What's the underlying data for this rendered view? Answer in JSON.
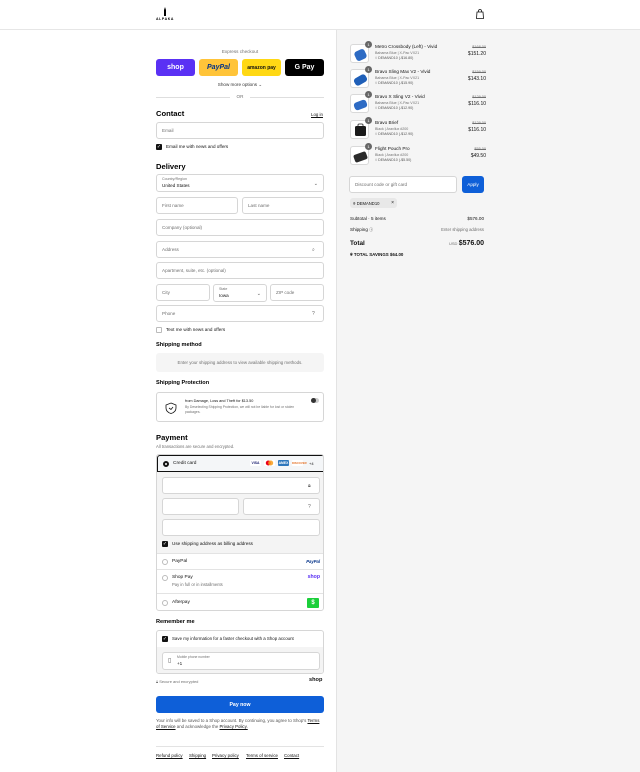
{
  "brand": {
    "name": "ALPAKA"
  },
  "express": {
    "title": "Express checkout",
    "buttons": [
      "shop",
      "PayPal",
      "amazon pay",
      "G Pay"
    ],
    "more": "Show more options",
    "or": "OR"
  },
  "contact": {
    "title": "Contact",
    "login": "Log in",
    "email_placeholder": "Email",
    "newsletter": "Email me with news and offers"
  },
  "delivery": {
    "title": "Delivery",
    "country_label": "Country/Region",
    "country_value": "United States",
    "first_name": "First name",
    "last_name": "Last name",
    "company": "Company (optional)",
    "address": "Address",
    "apartment": "Apartment, suite, etc. (optional)",
    "city": "City",
    "state_label": "State",
    "state_value": "Iowa",
    "zip": "ZIP code",
    "phone": "Phone",
    "text_offers": "Text me with news and offers"
  },
  "shipping_method": {
    "title": "Shipping method",
    "note": "Enter your shipping address to view available shipping methods."
  },
  "protection": {
    "title": "Shipping Protection",
    "line1": "from Damage, Loss and Theft for $13.50",
    "line2": "By Deselecting Shipping Protection, we will not be liable for lost or stolen",
    "line3": "packages."
  },
  "payment": {
    "title": "Payment",
    "subtitle": "All transactions are secure and encrypted.",
    "credit_card": "Credit card",
    "card_more": "+4",
    "billing_same": "Use shipping address as billing address",
    "options": [
      {
        "label": "PayPal",
        "logo": "PayPal"
      },
      {
        "label": "Shop Pay",
        "sub": "Pay in full or in installments",
        "logo": "shop"
      },
      {
        "label": "Afterpay",
        "logo": "$"
      }
    ]
  },
  "remember": {
    "title": "Remember me",
    "save_info": "Save my information for a faster checkout with a Shop account",
    "mobile_label": "Mobile phone number",
    "mobile_value": "+1",
    "secure": "Secure and encrypted",
    "shop_logo": "shop"
  },
  "pay_now": "Pay now",
  "legal": {
    "text1": "Your info will be saved to a Shop account. By continuing, you agree to Shop's",
    "terms": "Terms of Service",
    "and": "and acknowledge the",
    "privacy": "Privacy Policy."
  },
  "footer_links": [
    "Refund policy",
    "Shipping",
    "Privacy policy",
    "Terms of service",
    "Contact"
  ],
  "cart": {
    "items": [
      {
        "qty": "1",
        "name": "Metro Crossbody (Left) - Vivid",
        "variant": "Bahama Blue | X-Pac VX21",
        "code": "DEMAND10 (-$16.80)",
        "old": "$168.00",
        "price": "$151.20",
        "color": "#2d6bc4"
      },
      {
        "qty": "1",
        "name": "Bravo Sling Max V2 - Vivid",
        "variant": "Bahama Blue | X-Pac VX21",
        "code": "DEMAND10 (-$15.90)",
        "old": "$159.00",
        "price": "$143.10",
        "color": "#2d6bc4"
      },
      {
        "qty": "1",
        "name": "Bravo X Sling V2 - Vivid",
        "variant": "Bahama Blue | X-Pac VX21",
        "code": "DEMAND10 (-$12.90)",
        "old": "$129.00",
        "price": "$116.10",
        "color": "#2d6bc4"
      },
      {
        "qty": "1",
        "name": "Bravo Brief",
        "variant": "Black | Aravllux #200",
        "code": "DEMAND10 (-$12.90)",
        "old": "$129.00",
        "price": "$116.10",
        "color": "#1b1b1b"
      },
      {
        "qty": "1",
        "name": "Flight Pouch Pro",
        "variant": "Black | Aravllux #200",
        "code": "DEMAND10 (-$5.50)",
        "old": "$55.00",
        "price": "$49.50",
        "color": "#2a2a2a"
      }
    ],
    "discount_placeholder": "Discount code or gift card",
    "apply": "Apply",
    "applied_code": "DEMAND10",
    "subtotal_label": "Subtotal · 5 items",
    "subtotal": "$576.00",
    "shipping_label": "Shipping",
    "shipping_value": "Enter shipping address",
    "total_label": "Total",
    "currency": "USD",
    "total": "$576.00",
    "savings_label": "TOTAL SAVINGS",
    "savings": "$64.00"
  }
}
